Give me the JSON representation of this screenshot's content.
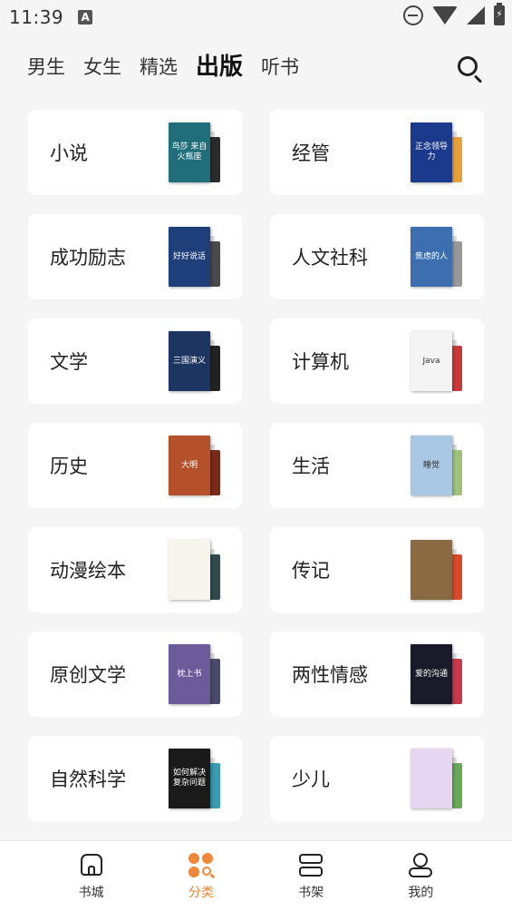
{
  "status_bar": {
    "time": "11:39",
    "notif_badge": "A"
  },
  "tabs": [
    {
      "label": "男生",
      "active": false
    },
    {
      "label": "女生",
      "active": false
    },
    {
      "label": "精选",
      "active": false
    },
    {
      "label": "出版",
      "active": true
    },
    {
      "label": "听书",
      "active": false
    }
  ],
  "categories": [
    {
      "label": "小说",
      "cover_color": "#1f6e7a",
      "back_color": "#2b2b2b",
      "cover_text": "鸟莎 来自 火瓶座"
    },
    {
      "label": "经管",
      "cover_color": "#1b3a8c",
      "back_color": "#e8a13a",
      "cover_text": "正念领导力"
    },
    {
      "label": "成功励志",
      "cover_color": "#1f3f7a",
      "back_color": "#4a4a4a",
      "cover_text": "好好说话"
    },
    {
      "label": "人文社科",
      "cover_color": "#3d6fb0",
      "back_color": "#9a9a9a",
      "cover_text": "焦虑的人"
    },
    {
      "label": "文学",
      "cover_color": "#1d3561",
      "back_color": "#222222",
      "cover_text": "三国演义"
    },
    {
      "label": "计算机",
      "cover_color": "#f4f4f4",
      "back_color": "#c83a3a",
      "cover_text": "Java"
    },
    {
      "label": "历史",
      "cover_color": "#b5512a",
      "back_color": "#7a2a1a",
      "cover_text": "大明"
    },
    {
      "label": "生活",
      "cover_color": "#a9c6e3",
      "back_color": "#9ec27a",
      "cover_text": "睡觉"
    },
    {
      "label": "动漫绘本",
      "cover_color": "#f7f4ee",
      "back_color": "#2e4a4a",
      "cover_text": ""
    },
    {
      "label": "传记",
      "cover_color": "#8a6a42",
      "back_color": "#d84a2a",
      "cover_text": ""
    },
    {
      "label": "原创文学",
      "cover_color": "#6b5b9a",
      "back_color": "#4a4a6a",
      "cover_text": "枕上书"
    },
    {
      "label": "两性情感",
      "cover_color": "#1a1a2a",
      "back_color": "#c83a4a",
      "cover_text": "爱的沟通"
    },
    {
      "label": "自然科学",
      "cover_color": "#1a1a1a",
      "back_color": "#3a9ab0",
      "cover_text": "如何解决 复杂问题"
    },
    {
      "label": "少儿",
      "cover_color": "#e6d6f2",
      "back_color": "#6aa85a",
      "cover_text": ""
    }
  ],
  "bottom_nav": [
    {
      "label": "书城",
      "icon": "home-icon",
      "active": false
    },
    {
      "label": "分类",
      "icon": "category-icon",
      "active": true
    },
    {
      "label": "书架",
      "icon": "bookshelf-icon",
      "active": false
    },
    {
      "label": "我的",
      "icon": "profile-icon",
      "active": false
    }
  ],
  "colors": {
    "accent": "#f0883a",
    "background": "#f5f5f5",
    "card": "#ffffff"
  }
}
